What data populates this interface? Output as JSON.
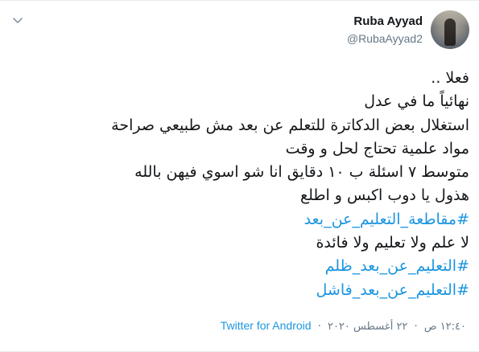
{
  "author": {
    "name": "Ruba Ayyad",
    "handle": "@RubaAyyad2"
  },
  "tweet": {
    "lines": [
      {
        "text": "فعلا ..",
        "hashtag": false
      },
      {
        "text": "نهائياً ما في عدل",
        "hashtag": false
      },
      {
        "text": "استغلال بعض الدكاترة للتعلم عن بعد مش طبيعي صراحة",
        "hashtag": false
      },
      {
        "text": "مواد علمية تحتاج لحل و وقت",
        "hashtag": false
      },
      {
        "text": "متوسط ٧ اسئلة ب ١٠ دقايق انا شو اسوي فيهن بالله",
        "hashtag": false
      },
      {
        "text": "هذول يا دوب اكبس و اطلع",
        "hashtag": false
      },
      {
        "text": "#مقاطعة_التعليم_عن_بعد",
        "hashtag": true
      },
      {
        "text": "لا علم ولا تعليم ولا فائدة",
        "hashtag": false
      },
      {
        "text": "#التعليم_عن_بعد_ظلم",
        "hashtag": true
      },
      {
        "text": "#التعليم_عن_بعد_فاشل",
        "hashtag": true
      }
    ]
  },
  "meta": {
    "time": "١٢:٤٠ ص",
    "date": "٢٢ أغسطس ٢٠٢٠",
    "separator": "·",
    "source": "Twitter for Android"
  },
  "icons": {
    "menu": "chevron-down-icon",
    "avatar": "profile-avatar"
  },
  "colors": {
    "hashtag": "#1b95e0",
    "muted": "#657786",
    "text": "#14171a"
  }
}
